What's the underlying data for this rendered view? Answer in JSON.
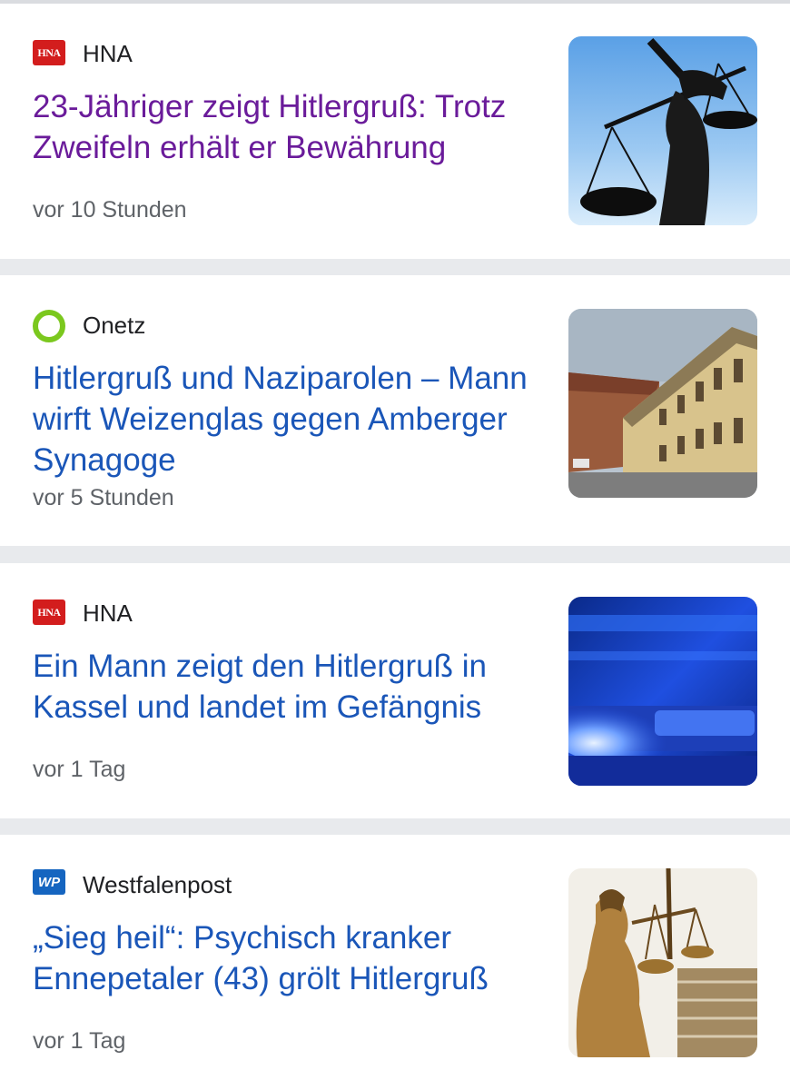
{
  "articles": [
    {
      "source": "HNA",
      "source_logo": "HNA",
      "headline": "23-Jähriger zeigt Hitlergruß: Trotz Zweifeln erhält er Bewährung",
      "time": "vor 10 Stunden",
      "visited": true,
      "thumbnail": "scales-of-justice-statue-icon"
    },
    {
      "source": "Onetz",
      "source_logo": "onetz-ring-logo",
      "headline": "Hitlergruß und Naziparolen – Mann wirft Weizenglas gegen Amberger Synagoge",
      "time": "vor 5 Stunden",
      "visited": false,
      "thumbnail": "building-street-photo"
    },
    {
      "source": "HNA",
      "source_logo": "HNA",
      "headline": "Ein Mann zeigt den Hitlergruß in Kassel und landet im Gefängnis",
      "time": "vor 1 Tag",
      "visited": false,
      "thumbnail": "police-blue-light-photo"
    },
    {
      "source": "Westfalenpost",
      "source_logo": "WP",
      "headline": "„Sieg heil“: Psychisch kranker Ennepetaler (43) grölt Hitlergruß",
      "time": "vor 1 Tag",
      "visited": false,
      "thumbnail": "justitia-statue-photo"
    }
  ],
  "colors": {
    "link": "#1a56b8",
    "visited_link": "#6a1b9a",
    "separator": "#e8eaed",
    "hna_red": "#d31d1d",
    "onetz_green": "#7bc81e",
    "wp_blue": "#1565c0"
  }
}
